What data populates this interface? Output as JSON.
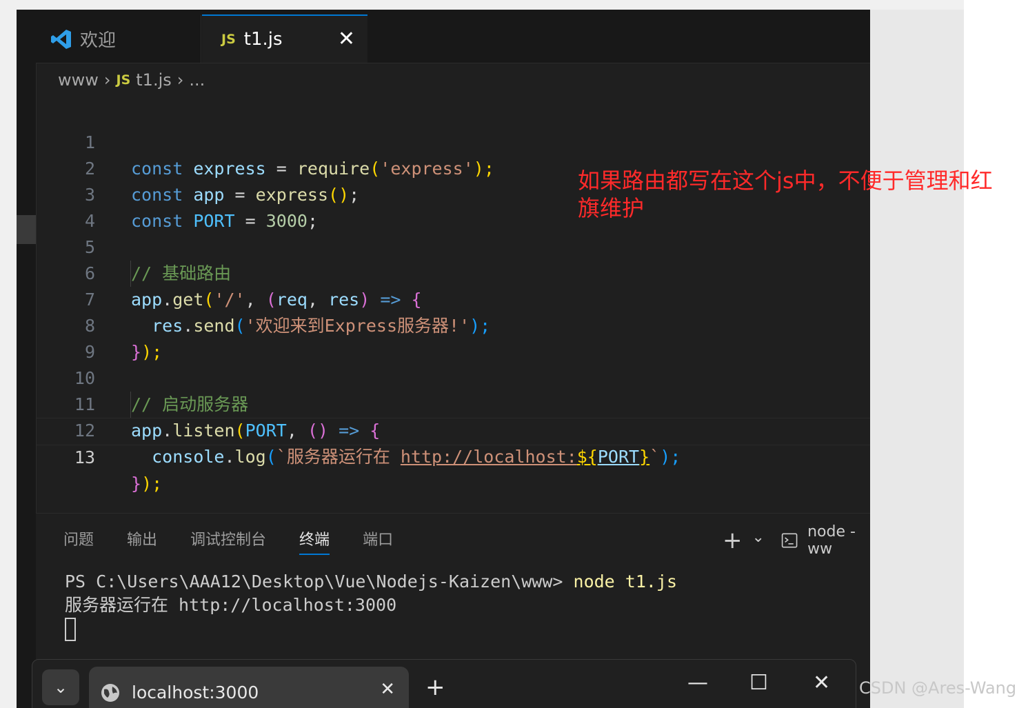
{
  "tabs": [
    {
      "label": "欢迎",
      "icon": "vscode-icon"
    },
    {
      "label": "t1.js",
      "icon": "js-icon",
      "badge": "JS",
      "close": "✕"
    }
  ],
  "breadcrumb": {
    "folder": "www",
    "sep": "›",
    "file": "t1.js",
    "more": "..."
  },
  "line_numbers": [
    "1",
    "2",
    "3",
    "4",
    "5",
    "6",
    "7",
    "8",
    "9",
    "10",
    "11",
    "12",
    "13"
  ],
  "code": {
    "l1": {
      "kw": "const",
      "var": "express",
      "eq": "=",
      "fn": "require",
      "o": "(",
      "str": "'express'",
      "c": ");"
    },
    "l2": {
      "kw": "const",
      "var": "app",
      "eq": "=",
      "fn": "express",
      "paren": "()",
      "semi": ";"
    },
    "l3": {
      "kw": "const",
      "const": "PORT",
      "eq": "=",
      "num": "3000",
      "semi": ";"
    },
    "l5": {
      "comment": "// 基础路由"
    },
    "l6": {
      "obj": "app",
      "dot": ".",
      "fn": "get",
      "o": "(",
      "str": "'/'",
      "comma": ",",
      "po": "(",
      "a1": "req",
      "c2": ",",
      "a2": "res",
      "pc": ")",
      "arrow": "=>",
      "brace": "{"
    },
    "l7": {
      "obj": "res",
      "dot": ".",
      "fn": "send",
      "o": "(",
      "str": "'欢迎来到Express服务器!'",
      "c": ");"
    },
    "l8": {
      "brace": "}",
      "c": ");"
    },
    "l10": {
      "comment": "// 启动服务器"
    },
    "l11": {
      "obj": "app",
      "dot": ".",
      "fn": "listen",
      "o": "(",
      "const": "PORT",
      "comma": ",",
      "paren": "()",
      "arrow": "=>",
      "brace": "{"
    },
    "l12": {
      "obj": "console",
      "dot": ".",
      "fn": "log",
      "o": "(",
      "tick": "`",
      "text": "服务器运行在 ",
      "url": "http://localhost:",
      "dollar": "${",
      "var": "PORT",
      "close": "}",
      "tick2": "`",
      "c": ");"
    },
    "l13": {
      "brace": "}",
      "c": ");"
    }
  },
  "annotation": {
    "text": "如果路由都写在这个js中，不便于管理和红旗维护",
    "color": "#ff2a2a"
  },
  "panel": {
    "tabs": [
      "问题",
      "输出",
      "调试控制台",
      "终端",
      "端口"
    ],
    "active_tab": "终端",
    "tools": {
      "plus": "+",
      "chevron": "⌄",
      "terminal_name": "node - ww"
    }
  },
  "terminal": {
    "prompt": "PS C:\\Users\\AAA12\\Desktop\\Vue\\Nodejs-Kaizen\\www> ",
    "command": "node t1.js",
    "output": "服务器运行在 http://localhost:3000"
  },
  "browser": {
    "tab_title": "localhost:3000",
    "tab_close": "✕",
    "new_tab": "+",
    "minimize": "—",
    "maximize": "☐",
    "close": "✕",
    "dropdown": "⌄"
  },
  "watermark": "CSDN @Ares-Wang",
  "colors": {
    "accent": "#0078d4",
    "editor_bg": "#1f1f1f",
    "annotation": "#ff2a2a"
  }
}
